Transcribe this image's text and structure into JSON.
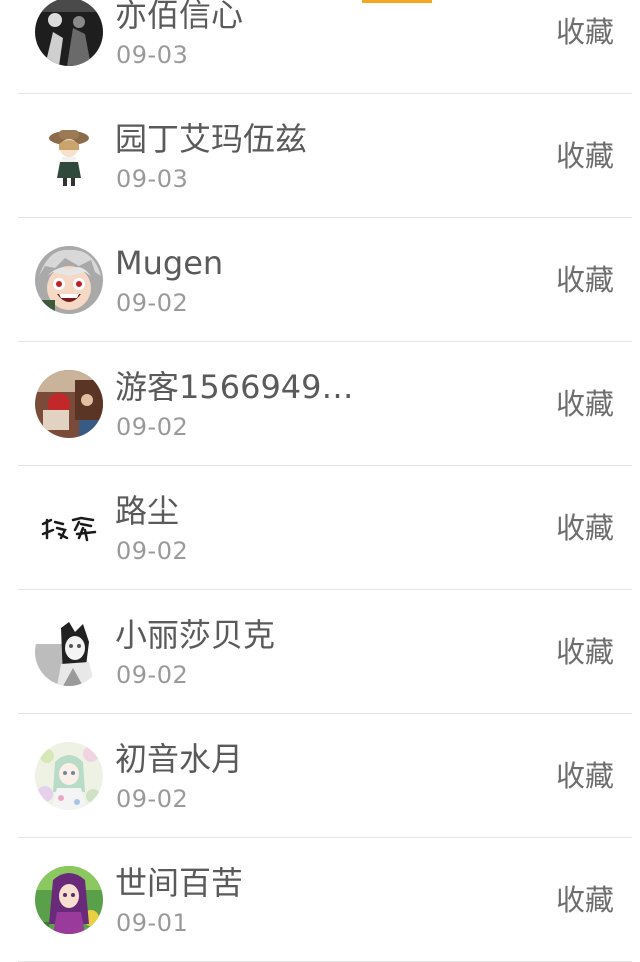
{
  "favorite_label": "收藏",
  "users": [
    {
      "name": "亦佰信心",
      "date": "09-03",
      "avatar_icon": "dark-figure-avatar",
      "avatar_color": "#2a2a2a"
    },
    {
      "name": "园丁艾玛伍兹",
      "date": "09-03",
      "avatar_icon": "chibi-gardener-avatar",
      "avatar_color": "#ffffff"
    },
    {
      "name": "Mugen",
      "date": "09-02",
      "avatar_icon": "angry-anime-boy-avatar",
      "avatar_color": "#b8b8b8"
    },
    {
      "name": "游客1566949…",
      "date": "09-02",
      "avatar_icon": "photo-avatar",
      "avatar_color": "#8a4a3a"
    },
    {
      "name": "路尘",
      "date": "09-02",
      "avatar_icon": "calligraphy-avatar",
      "avatar_color": "#ffffff"
    },
    {
      "name": "小丽莎贝克",
      "date": "09-02",
      "avatar_icon": "anime-girl-avatar",
      "avatar_color": "#d0d0d0"
    },
    {
      "name": "初音水月",
      "date": "09-02",
      "avatar_icon": "floral-anime-avatar",
      "avatar_color": "#e3ecd6"
    },
    {
      "name": "世间百苦",
      "date": "09-01",
      "avatar_icon": "purple-hair-girl-avatar",
      "avatar_color": "#3f8c3a"
    }
  ]
}
